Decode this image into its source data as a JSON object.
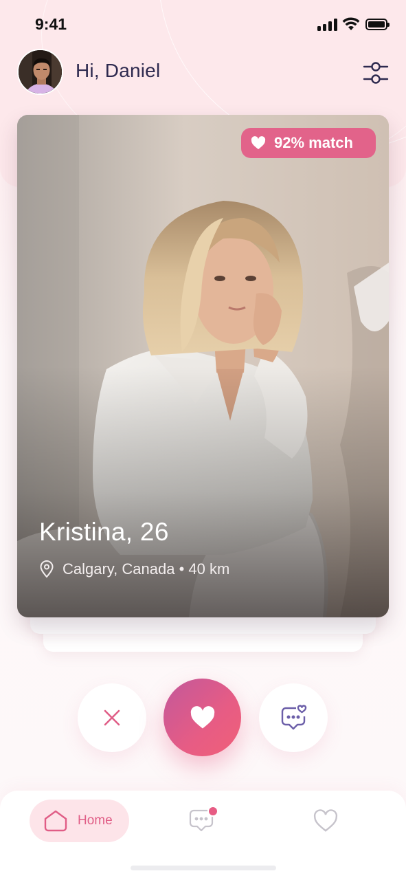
{
  "status_bar": {
    "time": "9:41"
  },
  "header": {
    "greeting": "Hi, Daniel"
  },
  "card": {
    "match_label": "92% match",
    "name": "Kristina, 26",
    "location": "Calgary, Canada • 40 km"
  },
  "actions": {
    "dislike_icon": "close-icon",
    "like_icon": "heart-icon",
    "chat_icon": "chat-heart-icon"
  },
  "bottom_nav": {
    "home_label": "Home",
    "messages_has_badge": true,
    "items": [
      "home-icon",
      "messages-icon",
      "heart-icon"
    ]
  },
  "colors": {
    "accent": "#e2638a",
    "like_gradient_start": "#c2589b",
    "like_gradient_end": "#f06078",
    "text_dark": "#2e2a4f",
    "chat_icon": "#6b5ea8"
  }
}
